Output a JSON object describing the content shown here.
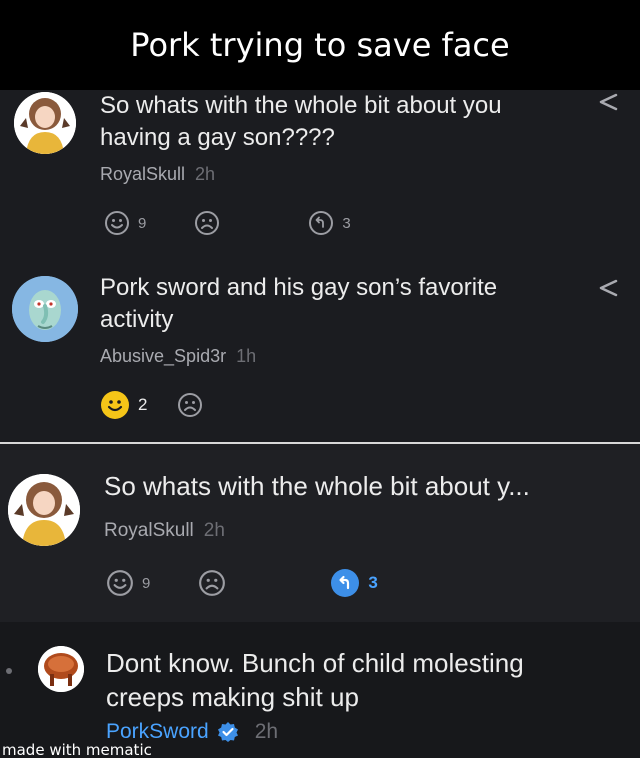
{
  "caption": "Pork trying to save face",
  "top_comments": [
    {
      "text_line1": "So whats with the whole bit about you",
      "text_line2": "having a gay son????",
      "username": "RoyalSkull",
      "time": "2h",
      "like_count": "9",
      "reply_count": "3"
    },
    {
      "text_line1": "Pork sword and his gay son’s favorite",
      "text_line2": "activity",
      "username": "Abusive_Spid3r",
      "time": "1h",
      "like_count": "2"
    }
  ],
  "bottom_comment": {
    "text": "So whats with the whole bit about y...",
    "username": "RoyalSkull",
    "time": "2h",
    "like_count": "9",
    "reply_count": "3"
  },
  "reply": {
    "text_line1": "Dont know. Bunch of child molesting",
    "text_line2": "creeps making shit up",
    "username": "PorkSword",
    "time": "2h"
  },
  "watermark": "made with mematic",
  "icons": {
    "share": "share-icon",
    "like": "smile-icon",
    "dislike": "frown-icon",
    "reply": "reply-icon",
    "verified": "verified-badge-icon"
  },
  "colors": {
    "background": "#1b1c20",
    "accent_blue": "#3d8fe8",
    "like_active": "#f5c518",
    "username_link": "#4aa3ff"
  }
}
